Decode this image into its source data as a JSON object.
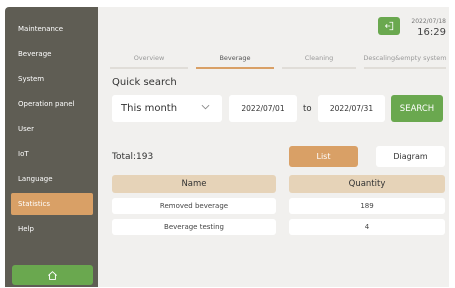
{
  "sidebar": {
    "items": [
      {
        "label": "Maintenance"
      },
      {
        "label": "Beverage"
      },
      {
        "label": "System"
      },
      {
        "label": "Operation panel"
      },
      {
        "label": "User"
      },
      {
        "label": "IoT"
      },
      {
        "label": "Language"
      },
      {
        "label": "Statistics",
        "active": true
      },
      {
        "label": "Help"
      }
    ],
    "home_icon": "home-icon"
  },
  "header": {
    "back_icon": "exit-icon",
    "date": "2022/07/18",
    "time": "16:29"
  },
  "tabs": [
    {
      "label": "Overview"
    },
    {
      "label": "Beverage",
      "active": true
    },
    {
      "label": "Cleaning"
    },
    {
      "label": "Descaling&empty system"
    }
  ],
  "search": {
    "label": "Quick search",
    "period": "This month",
    "date_from": "2022/07/01",
    "to_label": "to",
    "date_to": "2022/07/31",
    "button_label": "SEARCH"
  },
  "results": {
    "total": "Total:193",
    "view_list": "List",
    "view_diagram": "Diagram",
    "columns": [
      "Name",
      "Quantity"
    ],
    "rows": [
      {
        "name": "Removed beverage",
        "quantity": "189"
      },
      {
        "name": "Beverage testing",
        "quantity": "4"
      }
    ]
  },
  "colors": {
    "accent": "#d9a066",
    "green": "#6aa84f",
    "sidebar": "#5f5d54"
  }
}
